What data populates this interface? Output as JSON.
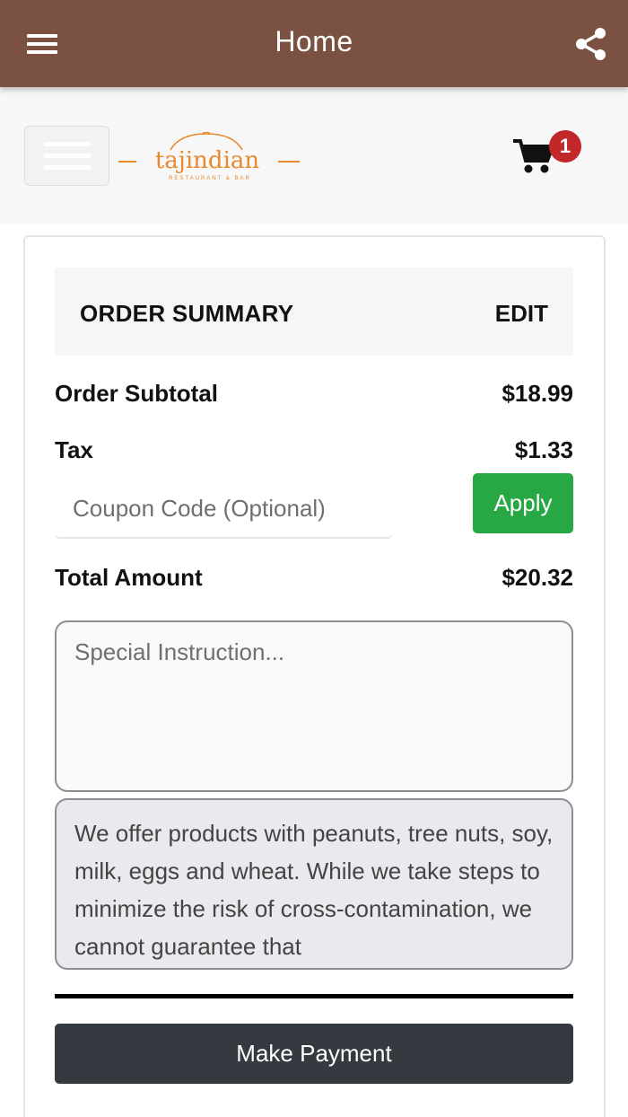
{
  "appbar": {
    "title": "Home",
    "menu_icon": "hamburger-icon",
    "share_icon": "share-icon",
    "color": "#7b5242"
  },
  "site_header": {
    "logo_text": "tajindian",
    "logo_subtext": "RESTAURANT & BAR",
    "cart_icon": "cart-icon",
    "cart_count": "1"
  },
  "summary": {
    "title": "ORDER SUMMARY",
    "edit_label": "EDIT",
    "subtotal_label": "Order Subtotal",
    "subtotal_value": "$18.99",
    "tax_label": "Tax",
    "tax_value": "$1.33",
    "coupon_placeholder": "Coupon Code (Optional)",
    "apply_label": "Apply",
    "total_label": "Total Amount",
    "total_value": "$20.32"
  },
  "instructions_placeholder": "Special Instruction...",
  "allergy_notice": "We offer products with peanuts, tree nuts, soy, milk, eggs and wheat. While we take steps to minimize the risk of cross-contamination, we cannot guarantee that",
  "payment_label": "Make Payment",
  "colors": {
    "apply": "#28a745",
    "pay": "#343a40",
    "badge": "#c0282a",
    "logo": "#e8892b"
  }
}
